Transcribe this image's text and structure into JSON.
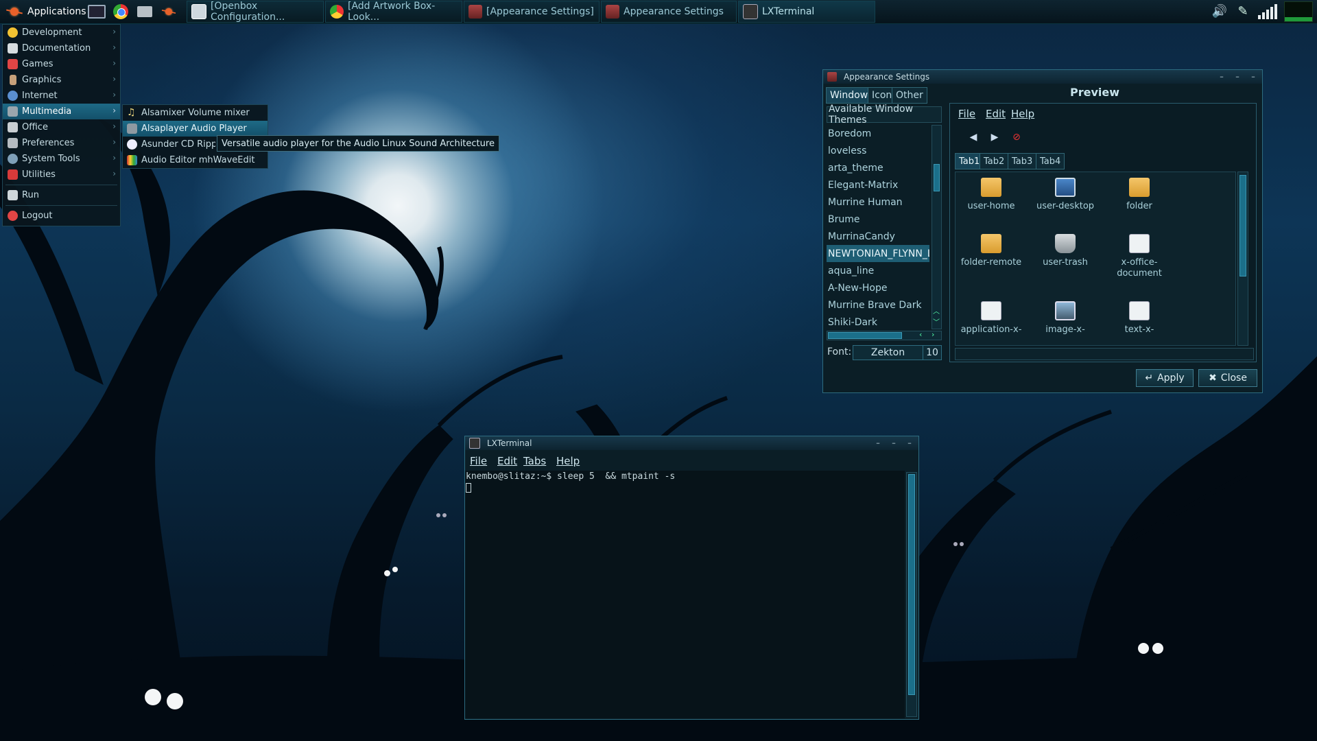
{
  "taskbar": {
    "apps_label": "Applications",
    "tasks": [
      {
        "label": "[Openbox Configuration...",
        "icon": "openbox-icon"
      },
      {
        "label": "[Add Artwork Box-Look...",
        "icon": "chrome-icon"
      },
      {
        "label": "[Appearance Settings]",
        "icon": "appearance-icon"
      },
      {
        "label": "Appearance Settings",
        "icon": "appearance-icon"
      },
      {
        "label": "LXTerminal",
        "icon": "terminal-icon"
      }
    ]
  },
  "app_menu": {
    "items": [
      {
        "label": "Development",
        "icon": "development-icon",
        "color": "#f2c232"
      },
      {
        "label": "Documentation",
        "icon": "documentation-icon",
        "color": "#d7dde0"
      },
      {
        "label": "Games",
        "icon": "games-icon",
        "color": "#e04545"
      },
      {
        "label": "Graphics",
        "icon": "graphics-icon",
        "color": "#c6a07a"
      },
      {
        "label": "Internet",
        "icon": "internet-icon",
        "color": "#5a8fd0"
      },
      {
        "label": "Multimedia",
        "icon": "multimedia-icon",
        "color": "#9aa6ad"
      },
      {
        "label": "Office",
        "icon": "office-icon",
        "color": "#c9ced2"
      },
      {
        "label": "Preferences",
        "icon": "preferences-icon",
        "color": "#b5bcc1"
      },
      {
        "label": "System Tools",
        "icon": "system-tools-icon",
        "color": "#7fa0b8"
      },
      {
        "label": "Utilities",
        "icon": "utilities-icon",
        "color": "#d83a3a"
      }
    ],
    "run_label": "Run",
    "logout_label": "Logout"
  },
  "multimedia_submenu": {
    "items": [
      {
        "label": "Alsamixer Volume mixer",
        "icon": "music-note-icon"
      },
      {
        "label": "Alsaplayer Audio Player",
        "icon": "audio-player-icon"
      },
      {
        "label": "Asunder CD Ripper",
        "icon": "cd-ripper-icon"
      },
      {
        "label": "Audio Editor mhWaveEdit",
        "icon": "audio-editor-icon"
      }
    ],
    "tooltip": "Versatile audio player for the Audio Linux Sound Architecture"
  },
  "appearance": {
    "title": "Appearance Settings",
    "tabs": [
      "Window",
      "Icon",
      "Other"
    ],
    "list_header": "Available Window Themes",
    "themes": [
      "Boredom",
      "loveless",
      "arta_theme",
      "Elegant-Matrix",
      "Murrine Human",
      "Brume",
      "MurrinaCandy",
      "NEWTONIAN_FLYNN_L",
      "aqua_line",
      "A-New-Hope",
      "Murrine Brave Dark",
      "Shiki-Dark"
    ],
    "selected_theme": "NEWTONIAN_FLYNN_L",
    "font_label": "Font:",
    "font_name": "Zekton",
    "font_size": "10",
    "preview": {
      "title": "Preview",
      "menu": [
        "File",
        "Edit",
        "Help"
      ],
      "tabs": [
        "Tab1",
        "Tab2",
        "Tab3",
        "Tab4"
      ],
      "icons": [
        {
          "label": "user-home",
          "icon": "folder-home-icon"
        },
        {
          "label": "user-desktop",
          "icon": "desktop-icon"
        },
        {
          "label": "folder",
          "icon": "folder-icon"
        },
        {
          "label": "folder-remote",
          "icon": "folder-remote-icon"
        },
        {
          "label": "user-trash",
          "icon": "trash-icon"
        },
        {
          "label": "x-office-document",
          "icon": "document-icon"
        },
        {
          "label": "application-x-",
          "icon": "application-icon"
        },
        {
          "label": "image-x-",
          "icon": "image-icon"
        },
        {
          "label": "text-x-",
          "icon": "text-icon"
        }
      ]
    },
    "apply_label": "Apply",
    "close_label": "Close"
  },
  "terminal": {
    "title": "LXTerminal",
    "menu": [
      "File",
      "Edit",
      "Tabs",
      "Help"
    ],
    "line": "knembo@slitaz:~$ sleep 5  && mtpaint -s"
  }
}
